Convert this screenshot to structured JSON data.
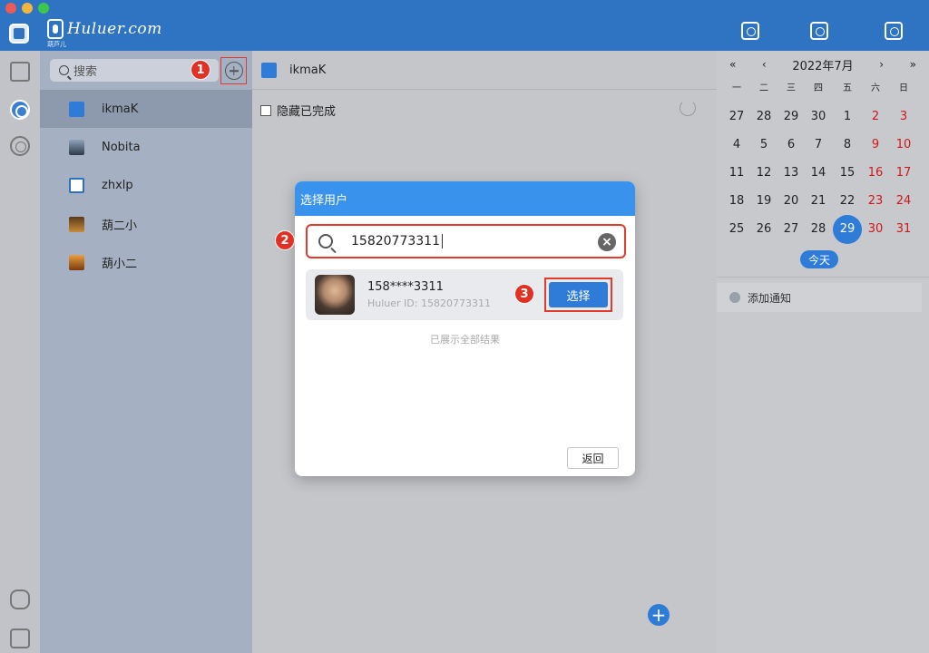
{
  "titlebar": {
    "logo_text": "Huluer.com",
    "logo_sub": "葫芦儿",
    "icons": [
      "search-doc-icon",
      "shield-star-icon",
      "calendar-grid-icon"
    ]
  },
  "rail": {
    "icons": [
      "brand-icon",
      "chat-icon",
      "grid-icon",
      "cloud-upload-icon",
      "settings-icon"
    ]
  },
  "contacts": {
    "search_placeholder": "搜索",
    "items": [
      {
        "name": "ikmaK",
        "selected": true,
        "avatar_color": "#2f7bd8"
      },
      {
        "name": "Nobita",
        "selected": false,
        "avatar_color": "#4a5a6e"
      },
      {
        "name": "zhxlp",
        "selected": false,
        "avatar_color": "#2f6fc0"
      },
      {
        "name": "葫二小",
        "selected": false,
        "avatar_color": "#8a5a2a"
      },
      {
        "name": "葫小二",
        "selected": false,
        "avatar_color": "#d88a2a"
      }
    ]
  },
  "main": {
    "header_name": "ikmaK",
    "hide_completed_label": "隐藏已完成"
  },
  "badges": [
    "1",
    "2",
    "3"
  ],
  "modal": {
    "title": "选择用户",
    "search_value": "15820773311",
    "result": {
      "display_name": "158****3311",
      "huluer_id": "Huluer ID: 15820773311",
      "select_label": "选择"
    },
    "all_shown": "已展示全部结果",
    "back_label": "返回"
  },
  "calendar": {
    "nav_prev_year": "«",
    "nav_prev_month": "‹",
    "title": "2022年7月",
    "nav_next_month": "›",
    "nav_next_year": "»",
    "dow": [
      "一",
      "二",
      "三",
      "四",
      "五",
      "六",
      "日"
    ],
    "weeks": [
      [
        "27",
        "28",
        "29",
        "30",
        "1",
        "2",
        "3"
      ],
      [
        "4",
        "5",
        "6",
        "7",
        "8",
        "9",
        "10"
      ],
      [
        "11",
        "12",
        "13",
        "14",
        "15",
        "16",
        "17"
      ],
      [
        "18",
        "19",
        "20",
        "21",
        "22",
        "23",
        "24"
      ],
      [
        "25",
        "26",
        "27",
        "28",
        "29",
        "30",
        "31"
      ]
    ],
    "today_value": "29",
    "today_label": "今天",
    "add_notice_label": "添加通知",
    "accent_color": "#2f7bd8",
    "weekend_color": "#d01818"
  }
}
